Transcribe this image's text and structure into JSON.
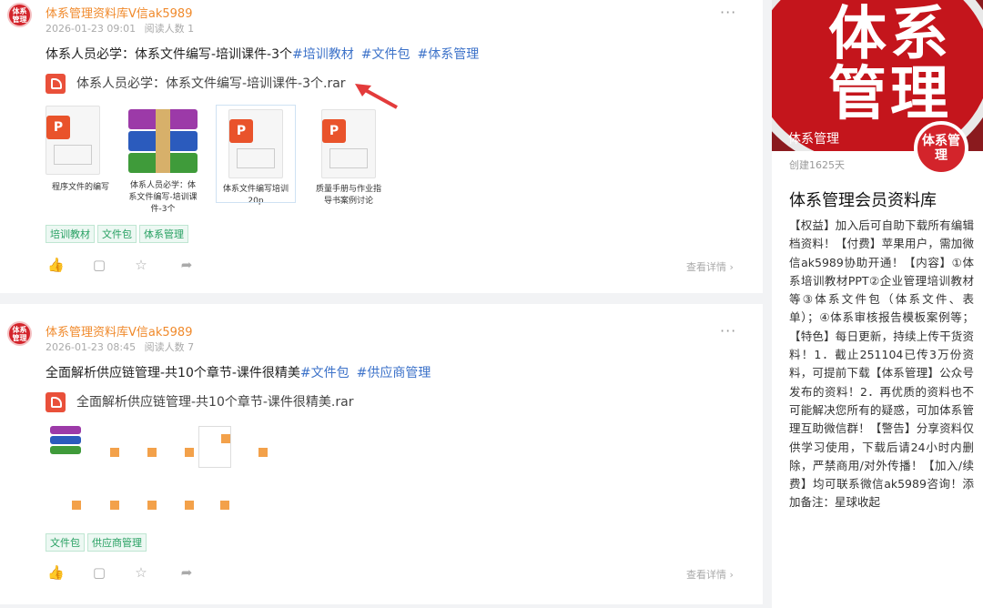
{
  "posts": [
    {
      "author": "体系管理资料库V信ak5989",
      "date": "2026-01-23 09:01",
      "reads": "阅读人数 1",
      "title": "体系人员必学：体系文件编写-培训课件-3个",
      "hashtags": [
        "#培训教材",
        "#文件包",
        "#体系管理"
      ],
      "filename": "体系人员必学：体系文件编写-培训课件-3个.rar",
      "files": [
        {
          "label": "程序文件的编写",
          "kind": "ppt"
        },
        {
          "label": "体系人员必学：体系文件编写-培训课件-3个",
          "kind": "rar"
        },
        {
          "label": "体系文件编写培训20p",
          "kind": "ppt"
        },
        {
          "label": "质量手册与作业指导书案例讨论",
          "kind": "ppt"
        }
      ],
      "tags": [
        "培训教材",
        "文件包",
        "体系管理"
      ],
      "detail": "查看详情 ›"
    },
    {
      "author": "体系管理资料库V信ak5989",
      "date": "2026-01-23 08:45",
      "reads": "阅读人数 7",
      "title": "全面解析供应链管理-共10个章节-课件很精美",
      "hashtags": [
        "#文件包",
        "#供应商管理"
      ],
      "filename": "全面解析供应链管理-共10个章节-课件很精美.rar",
      "tags": [
        "文件包",
        "供应商管理"
      ],
      "detail": "查看详情 ›"
    }
  ],
  "avatar_text": "体系管理",
  "more": "···",
  "sidebar": {
    "banner_title": "体系管理",
    "banner_big": "体系管理",
    "logo_text": "体系管理",
    "created": "创建1625天",
    "title": "体系管理会员资料库",
    "body": "【权益】加入后可自助下载所有编辑档资料！【付费】苹果用户，需加微信ak5989协助开通！【内容】①体系培训教材PPT②企业管理培训教材等③体系文件包（体系文件、表单）；④体系审核报告模板案例等；【特色】每日更新，持续上传干货资料！1．截止251104已传3万份资料，可提前下载【体系管理】公众号发布的资料！2．再优质的资料也不可能解决您所有的疑惑，可加体系管理互助微信群！【警告】分享资料仅供学习使用，下载后请24小时内删除，严禁商用/对外传播！【加入/续费】均可联系微信ak5989咨询！添加备注：星球收起"
  },
  "colors": {
    "brand_red": "#d3242b",
    "author_orange": "#f08a2c",
    "tag_green": "#27a062",
    "hashtag_blue": "#3c72c9"
  }
}
